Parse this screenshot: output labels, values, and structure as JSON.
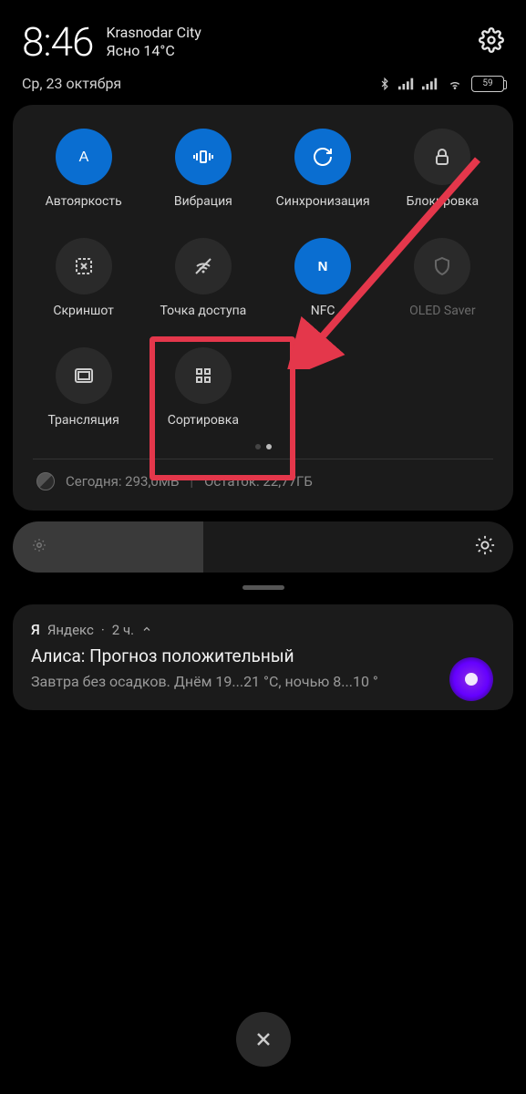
{
  "header": {
    "time": "8:46",
    "location": "Krasnodar City",
    "weather": "Ясно 14°C",
    "date": "Ср, 23 октября",
    "battery": "59"
  },
  "tiles": [
    {
      "label": "Автояркость",
      "active": true,
      "dim": false
    },
    {
      "label": "Вибрация",
      "active": true,
      "dim": false
    },
    {
      "label": "Синхронизация",
      "active": true,
      "dim": false
    },
    {
      "label": "Блокировка",
      "active": false,
      "dim": false
    },
    {
      "label": "Скриншот",
      "active": false,
      "dim": false
    },
    {
      "label": "Точка доступа",
      "active": false,
      "dim": false
    },
    {
      "label": "NFC",
      "active": true,
      "dim": false
    },
    {
      "label": "OLED Saver",
      "active": false,
      "dim": true
    },
    {
      "label": "Трансляция",
      "active": false,
      "dim": false
    },
    {
      "label": "Сортировка",
      "active": false,
      "dim": false
    }
  ],
  "data_usage": {
    "today_label": "Сегодня: 293,0МБ",
    "remaining_label": "Остаток: 22,77ГБ"
  },
  "notification": {
    "app": "Яндекс",
    "time": "2 ч.",
    "app_letter": "Я",
    "title": "Алиса: Прогноз положительный",
    "body": "Завтра без осадков. Днём 19...21 °C, ночью 8...10 °"
  },
  "annotation": {
    "highlight_tile_index": 9
  }
}
